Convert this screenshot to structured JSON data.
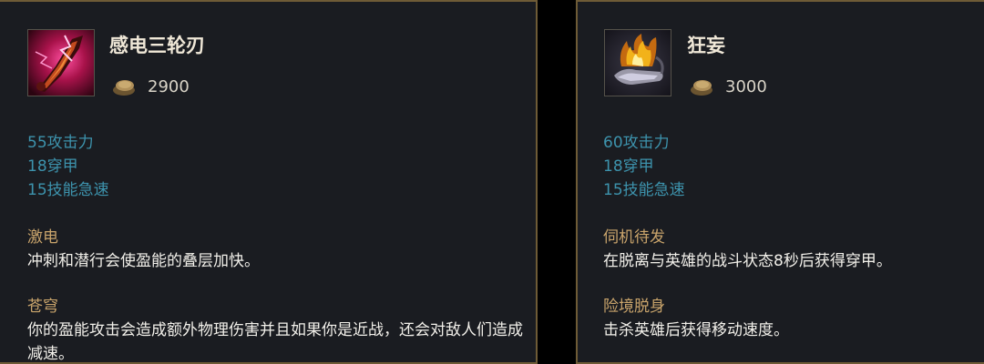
{
  "items": [
    {
      "name": "感电三轮刃",
      "cost": "2900",
      "stats": [
        "55攻击力",
        "18穿甲",
        "15技能急速"
      ],
      "passives": [
        {
          "name": "激电",
          "description": "冲刺和潜行会使盈能的叠层加快。"
        },
        {
          "name": "苍穹",
          "description": "你的盈能攻击会造成额外物理伤害并且如果你是近战，还会对敌人们造成减速。"
        }
      ]
    },
    {
      "name": "狂妄",
      "cost": "3000",
      "stats": [
        "60攻击力",
        "18穿甲",
        "15技能急速"
      ],
      "passives": [
        {
          "name": "伺机待发",
          "description": "在脱离与英雄的战斗状态8秒后获得穿甲。"
        },
        {
          "name": "险境脱身",
          "description": "击杀英雄后获得移动速度。"
        }
      ]
    }
  ],
  "colors": {
    "panel_bg": "#1a1c21",
    "border": "#6e5b36",
    "title": "#f0e8d8",
    "stat": "#3d93ad",
    "passive_name": "#c9a46b",
    "text": "#f2f0ea"
  },
  "icons": [
    "lightning-blade-item-icon",
    "flaming-hand-item-icon",
    "gold-coin-icon"
  ]
}
